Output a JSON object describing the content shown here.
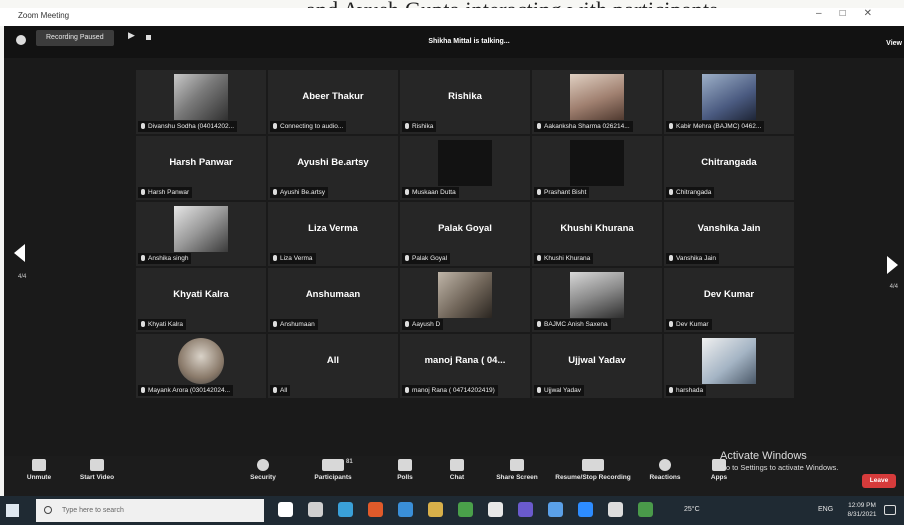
{
  "caption": "and Ayush Gupta interacting with participants",
  "window": {
    "title": "Zoom Meeting",
    "controls": [
      "–",
      "□",
      "✕"
    ]
  },
  "topbar": {
    "recording_label": "Recording Paused",
    "talking_text": "Shikha Mittal is talking...",
    "view_label": "View"
  },
  "grid": {
    "rows": [
      [
        {
          "name": "",
          "label": "Divanshu Sodha (04014202...",
          "photo": "a"
        },
        {
          "name": "Abeer Thakur",
          "label": "Connecting to audio...",
          "photo": ""
        },
        {
          "name": "Rishika",
          "label": "Rishika",
          "photo": ""
        },
        {
          "name": "",
          "label": "Aakanksha Sharma 026214...",
          "photo": "b"
        },
        {
          "name": "",
          "label": "Kabir Mehra (BAJMC) 0462...",
          "photo": "c"
        }
      ],
      [
        {
          "name": "Harsh Panwar",
          "label": "Harsh Panwar",
          "photo": ""
        },
        {
          "name": "Ayushi Be.artsy",
          "label": "Ayushi Be.artsy",
          "photo": ""
        },
        {
          "name": "",
          "label": "Muskaan Dutta",
          "photo": "dark"
        },
        {
          "name": "",
          "label": "Prashant Bisht",
          "photo": "dark"
        },
        {
          "name": "Chitrangada",
          "label": "Chitrangada",
          "photo": ""
        }
      ],
      [
        {
          "name": "",
          "label": "Anshika singh",
          "photo": "d"
        },
        {
          "name": "Liza Verma",
          "label": "Liza Verma",
          "photo": ""
        },
        {
          "name": "Palak Goyal",
          "label": "Palak Goyal",
          "photo": ""
        },
        {
          "name": "Khushi Khurana",
          "label": "Khushi Khurana",
          "photo": ""
        },
        {
          "name": "Vanshika Jain",
          "label": "Vanshika Jain",
          "photo": ""
        }
      ],
      [
        {
          "name": "Khyati Kalra",
          "label": "Khyati Kalra",
          "photo": ""
        },
        {
          "name": "Anshumaan",
          "label": "Anshumaan",
          "photo": ""
        },
        {
          "name": "",
          "label": "Aayush D",
          "photo": "e"
        },
        {
          "name": "",
          "label": "BAJMC Anish Saxena",
          "photo": "f"
        },
        {
          "name": "Dev Kumar",
          "label": "Dev Kumar",
          "photo": ""
        }
      ],
      [
        {
          "name": "",
          "label": "Mayank Arora (030142024...",
          "photo": "round"
        },
        {
          "name": "All",
          "label": "All",
          "photo": ""
        },
        {
          "name": "manoj Rana ( 04...",
          "label": "manoj Rana ( 04714202419)",
          "photo": ""
        },
        {
          "name": "Ujjwal Yadav",
          "label": "Ujjwal Yadav",
          "photo": ""
        },
        {
          "name": "",
          "label": "harshada",
          "photo": "g"
        }
      ]
    ]
  },
  "nav": {
    "left_page": "4/4",
    "right_page": "4/4"
  },
  "activate": {
    "title": "Activate Windows",
    "subtitle": "Go to Settings to activate Windows."
  },
  "toolbar": {
    "unmute": "Unmute",
    "start_video": "Start Video",
    "security": "Security",
    "participants": "Participants",
    "participants_count": "81",
    "polls": "Polls",
    "chat": "Chat",
    "share_screen": "Share Screen",
    "recording": "Resume/Stop Recording",
    "reactions": "Reactions",
    "apps": "Apps",
    "leave": "Leave"
  },
  "taskbar": {
    "search_placeholder": "Type here to search",
    "weather": "25°C",
    "lang": "ENG",
    "time": "12:09 PM",
    "date": "8/31/2021",
    "icon_colors": [
      "#ffffff",
      "#cfcfcf",
      "#3aa0d8",
      "#e05a2a",
      "#3a8fd8",
      "#d8b04a",
      "#4aa04a",
      "#e8e8e8",
      "#6a5acd",
      "#5aa0e8",
      "#2d8cff",
      "#dddddd",
      "#4a9a4a"
    ]
  }
}
